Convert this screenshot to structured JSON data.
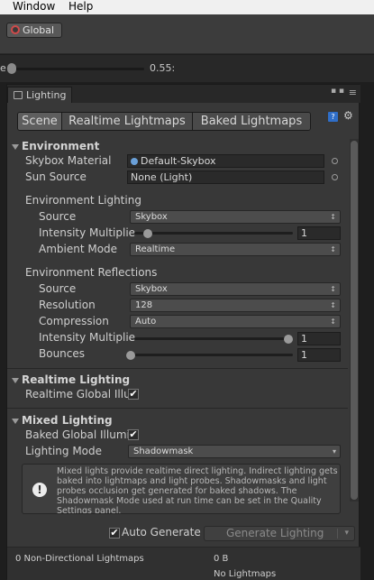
{
  "menubar": {
    "items": [
      "Window",
      "Help"
    ]
  },
  "toolbar": {
    "global_label": "Global"
  },
  "sliderbar": {
    "lead_label": "e",
    "value_text": "0.55:",
    "value": 0.0
  },
  "panel": {
    "tab_title": "Lighting",
    "dots": "▪ ▪",
    "menu_glyph": "≡"
  },
  "tabs": [
    "Scene",
    "Realtime Lightmaps",
    "Baked Lightmaps"
  ],
  "environment": {
    "header": "Environment",
    "skybox_material_label": "Skybox Material",
    "skybox_material_value": "Default-Skybox",
    "sun_source_label": "Sun Source",
    "sun_source_value": "None (Light)",
    "lighting_header": "Environment Lighting",
    "source_label": "Source",
    "source_value": "Skybox",
    "intensity_label": "Intensity Multiplie",
    "intensity_value": "1",
    "ambient_mode_label": "Ambient Mode",
    "ambient_mode_value": "Realtime",
    "reflections_header": "Environment Reflections",
    "refl_source_label": "Source",
    "refl_source_value": "Skybox",
    "resolution_label": "Resolution",
    "resolution_value": "128",
    "compression_label": "Compression",
    "compression_value": "Auto",
    "refl_intensity_label": "Intensity Multiplie",
    "refl_intensity_value": "1",
    "bounces_label": "Bounces",
    "bounces_value": "1"
  },
  "realtime": {
    "header": "Realtime Lighting",
    "gi_label": "Realtime Global Illu"
  },
  "mixed": {
    "header": "Mixed Lighting",
    "baked_gi_label": "Baked Global Illumi",
    "lighting_mode_label": "Lighting Mode",
    "lighting_mode_value": "Shadowmask",
    "info_text": "Mixed lights provide realtime direct lighting. Indirect lighting gets baked into lightmaps and light probes. Shadowmasks and light probes occlusion get generated for baked shadows. The Shadowmask Mode used at run time can be set in the Quality Settings panel."
  },
  "bottom": {
    "auto_generate_label": "Auto Generate",
    "generate_button_label": "Generate Lighting"
  },
  "stats": {
    "lightmaps_label": "0 Non-Directional Lightmaps",
    "size_value": "0 B",
    "status_text": "No Lightmaps"
  },
  "glyphs": {
    "check": "✔",
    "arrow": "▾",
    "updown": "↕",
    "info": "!",
    "help": "?",
    "gear": "⚙"
  },
  "colors": {
    "accent": "#2f6ec8",
    "panel_bg": "#383838",
    "toolbar_bg": "#3c3c3c",
    "menubar_bg": "#f0f0f0"
  }
}
